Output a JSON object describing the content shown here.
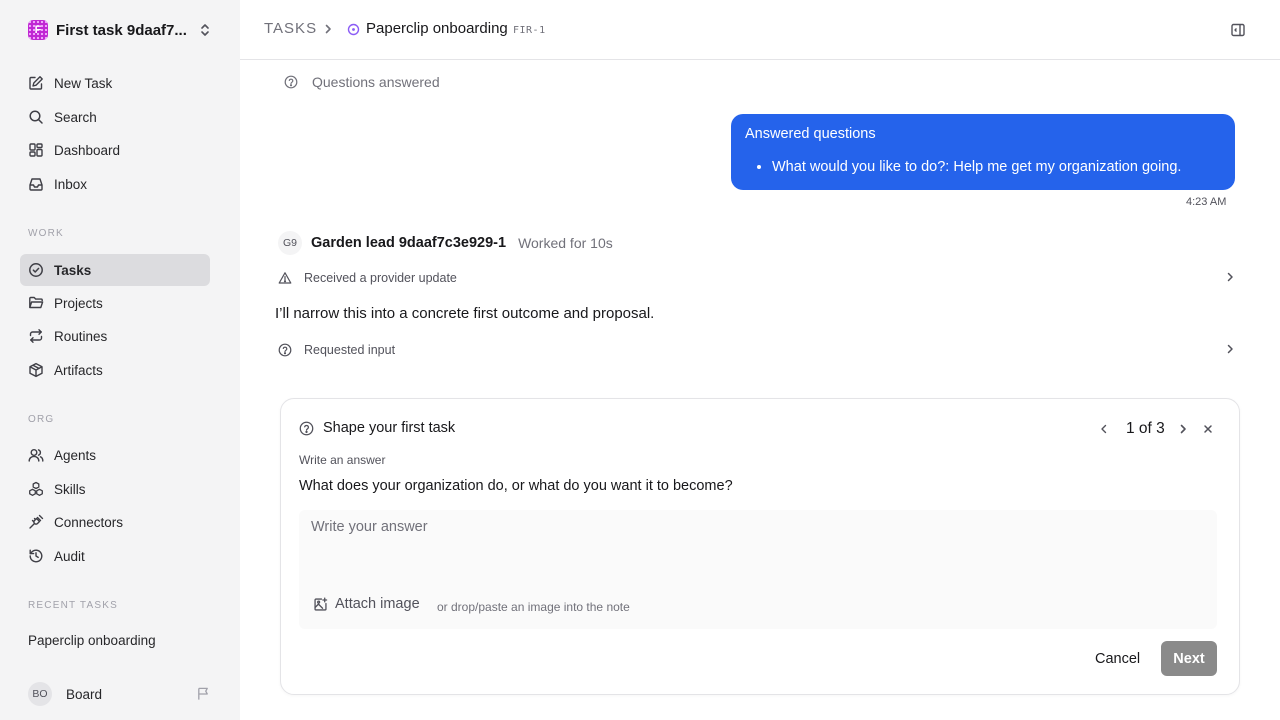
{
  "workspace": {
    "logo_letter": "F",
    "name": "First task 9daaf7..."
  },
  "nav": {
    "new_task": "New Task",
    "search": "Search",
    "dashboard": "Dashboard",
    "inbox": "Inbox"
  },
  "sections": {
    "work": "WORK",
    "org": "ORG",
    "recent": "RECENT TASKS"
  },
  "work_items": [
    "Tasks",
    "Projects",
    "Routines",
    "Artifacts"
  ],
  "org_items": [
    "Agents",
    "Skills",
    "Connectors",
    "Audit"
  ],
  "recent_tasks": [
    "Paperclip onboarding"
  ],
  "board": {
    "initials": "BO",
    "name": "Board"
  },
  "header": {
    "section": "TASKS",
    "title": "Paperclip onboarding",
    "task_id": "FIR-1"
  },
  "thread": {
    "questions_answered": "Questions answered",
    "bubble_title": "Answered questions",
    "bubble_items": [
      "What would you like to do?: Help me get my organization going."
    ],
    "bubble_time": "4:23 AM",
    "agent_initials": "G9",
    "agent_name": "Garden lead 9daaf7c3e929-1",
    "agent_worked": "Worked for 10s",
    "event_provider": "Received a provider update",
    "message": "I’ll narrow this into a concrete first outcome and proposal.",
    "event_input": "Requested input"
  },
  "card": {
    "title": "Shape your first task",
    "pager": "1 of 3",
    "hint": "Write an answer",
    "question": "What does your organization do, or what do you want it to become?",
    "answer_value": "",
    "answer_placeholder": "Write your answer",
    "attach_label": "Attach image",
    "attach_hint": "or drop/paste an image into the note",
    "cancel_label": "Cancel",
    "next_label": "Next"
  },
  "colors": {
    "accent_blue": "#2563eb",
    "status_violet": "#8b5cf6",
    "workspace_logo": "#c026d3",
    "disabled_button": "#8a8a8a"
  }
}
